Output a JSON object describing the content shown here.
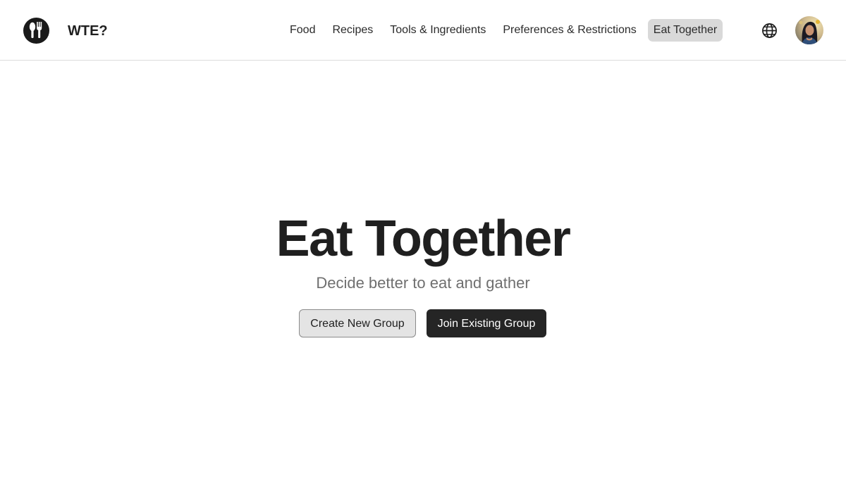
{
  "header": {
    "brand": "WTE?",
    "logo_icon": "fork-spoon-icon",
    "nav": [
      {
        "label": "Food",
        "active": false
      },
      {
        "label": "Recipes",
        "active": false
      },
      {
        "label": "Tools & Ingredients",
        "active": false
      },
      {
        "label": "Preferences & Restrictions",
        "active": false
      },
      {
        "label": "Eat Together",
        "active": true
      }
    ],
    "language_icon": "globe-icon",
    "avatar_icon": "user-avatar"
  },
  "hero": {
    "title": "Eat Together",
    "subtitle": "Decide better to eat and gather",
    "create_label": "Create New Group",
    "join_label": "Join Existing Group"
  },
  "colors": {
    "accent_dark": "#252525",
    "active_nav_bg": "#d9d9d9",
    "subtitle_text": "#6f6f6f"
  }
}
